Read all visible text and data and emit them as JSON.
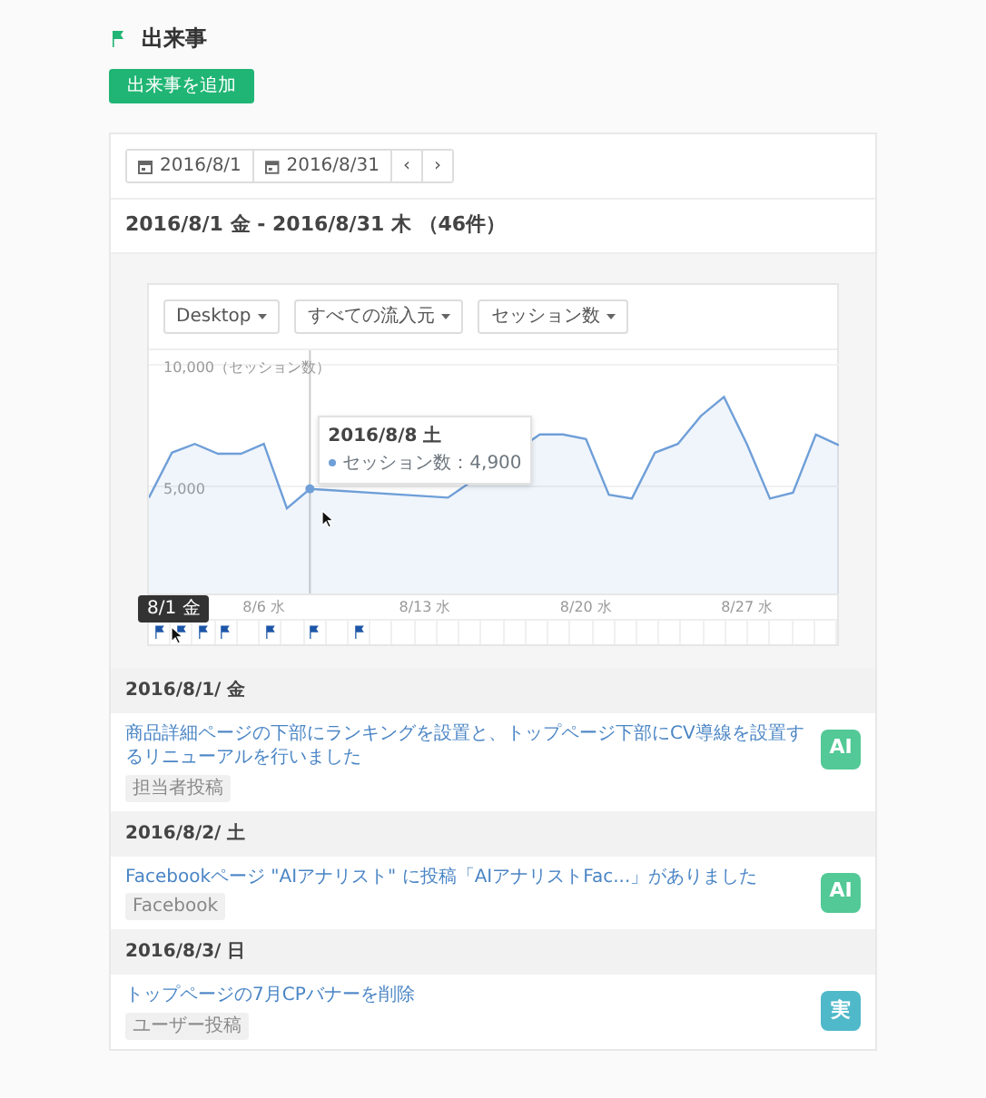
{
  "page_title": "出来事",
  "add_button": "出来事を追加",
  "date_range": {
    "start": "2016/8/1",
    "end": "2016/8/31",
    "prev": "‹",
    "next": "›"
  },
  "range_title": "2016/8/1 金 - 2016/8/31 木 （46件）",
  "chart": {
    "filters": [
      {
        "label": "Desktop"
      },
      {
        "label": "すべての流入元"
      },
      {
        "label": "セッション数"
      }
    ],
    "chart_data": {
      "type": "area",
      "categories": [
        null,
        null,
        null,
        null,
        null,
        "8/6 水",
        null,
        null,
        null,
        null,
        null,
        null,
        "8/13 水",
        null,
        null,
        null,
        null,
        null,
        null,
        "8/20 水",
        null,
        null,
        null,
        null,
        null,
        null,
        "8/27 水",
        null,
        null,
        null,
        null
      ],
      "series": [
        {
          "name": "セッション数",
          "color": "#6f9fd8",
          "values": [
            4540,
            6390,
            6750,
            6350,
            6350,
            6750,
            4100,
            4900,
            null,
            null,
            null,
            null,
            null,
            4540,
            null,
            null,
            null,
            7140,
            7140,
            6950,
            4660,
            4500,
            6390,
            6750,
            7900,
            8680,
            6750,
            4500,
            4740,
            7140,
            6700
          ]
        }
      ],
      "ylim": [
        600,
        10600
      ],
      "yticks": [
        {
          "value": 5000,
          "label": "5,000"
        },
        {
          "value": 10000,
          "label": "10,000（セッション数）"
        }
      ]
    },
    "hover_tooltip": {
      "title": "2016/8/8 土",
      "value": "：4,900"
    },
    "date_tooltip": "8/1 金",
    "event_flags": [
      {
        "flagged": true
      },
      {
        "flagged": true
      },
      {
        "flagged": true
      },
      {
        "flagged": true
      },
      {
        "flagged": false
      },
      {
        "flagged": true
      },
      {
        "flagged": false
      },
      {
        "flagged": true
      },
      {
        "flagged": false
      },
      {
        "flagged": true
      },
      {
        "flagged": false
      },
      {
        "flagged": false
      },
      {
        "flagged": false
      },
      {
        "flagged": false
      },
      {
        "flagged": false
      },
      {
        "flagged": false
      },
      {
        "flagged": false
      },
      {
        "flagged": false
      },
      {
        "flagged": false
      },
      {
        "flagged": false
      },
      {
        "flagged": false
      },
      {
        "flagged": false
      },
      {
        "flagged": false
      },
      {
        "flagged": false
      },
      {
        "flagged": false
      },
      {
        "flagged": false
      },
      {
        "flagged": false
      },
      {
        "flagged": false
      },
      {
        "flagged": false
      },
      {
        "flagged": false
      },
      {
        "flagged": false
      }
    ]
  },
  "days": [
    {
      "date": "2016/8/1/ 金",
      "events": [
        {
          "title": "商品詳細ページの下部にランキングを設置と、トップページ下部にCV導線を設置するリニューアルを行いました",
          "tag": "担当者投稿",
          "badge": "AI",
          "color": "#52c996"
        }
      ]
    },
    {
      "date": "2016/8/2/ 土",
      "events": [
        {
          "title": "Facebookページ \"AIアナリスト\" に投稿「AIアナリストFac...」がありました",
          "tag": "Facebook",
          "badge": "AI",
          "color": "#52c996"
        }
      ]
    },
    {
      "date": "2016/8/3/ 日",
      "events": [
        {
          "title": "トップページの7月CPバナーを削除",
          "tag": "ユーザー投稿",
          "badge": "実",
          "color": "#4fb9c9"
        }
      ]
    }
  ]
}
